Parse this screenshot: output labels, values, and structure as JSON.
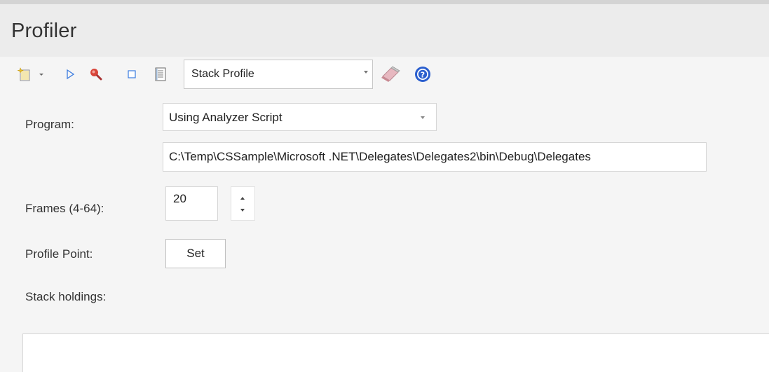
{
  "window": {
    "title": "Profiler"
  },
  "toolbar": {
    "icons": [
      "new-item-icon",
      "dropdown-arrow-icon",
      "play-icon",
      "search-icon",
      "stop-icon",
      "report-icon",
      "eraser-icon",
      "help-icon"
    ],
    "profile_type": "Stack Profile"
  },
  "form": {
    "program_label": "Program:",
    "program_value": "Using Analyzer Script",
    "path_value": "C:\\Temp\\CSSample\\Microsoft .NET\\Delegates\\Delegates2\\bin\\Debug\\Delegates",
    "frames_label": "Frames (4-64):",
    "frames_value": "20",
    "profile_point_label": "Profile Point:",
    "set_button_label": "Set",
    "stack_holdings_label": "Stack holdings:"
  },
  "colors": {
    "accent_blue": "#2b5fce",
    "search_red": "#d9453a",
    "new_item_yellow": "#e8c02e"
  }
}
